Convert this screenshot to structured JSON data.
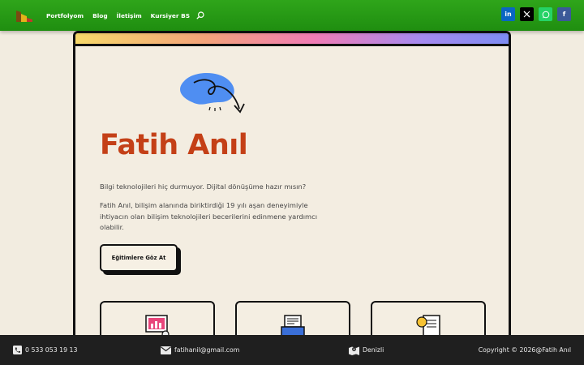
{
  "nav": {
    "items": [
      "Portfolyom",
      "Blog",
      "İletişim",
      "Kursiyer BS"
    ],
    "search_icon": "search-icon"
  },
  "social": [
    {
      "name": "linkedin-icon",
      "glyph": "in",
      "color": "#0a66c2"
    },
    {
      "name": "x-twitter-icon",
      "glyph": "𝕏",
      "color": "#000000"
    },
    {
      "name": "whatsapp-icon",
      "glyph": "✆",
      "color": "#25d366"
    },
    {
      "name": "facebook-icon",
      "glyph": "f",
      "color": "#3b5998"
    }
  ],
  "hero": {
    "title": "Fatih Anıl",
    "tagline": "Bilgi teknolojileri hiç durmuyor. Dijital dönüşüme hazır mısın?",
    "description": "Fatih Anıl, bilişim alanında biriktirdiği 19 yılı aşan deneyimiyle ihtiyacın olan bilişim teknolojileri becerilerini edinmene yardımcı olabilir.",
    "cta_label": "Eğitimlere Göz At"
  },
  "colors": {
    "nav_green": "#2fa51a",
    "title_orange": "#c44017",
    "footer_bg": "#1f1f1f",
    "page_bg": "#f2ece0"
  },
  "footer": {
    "phone": "0 533 053 19 13",
    "email": "fatihanil@gmail.com",
    "location": "Denizli",
    "copyright": "Copyright © 2026@Fatih Anıl"
  }
}
